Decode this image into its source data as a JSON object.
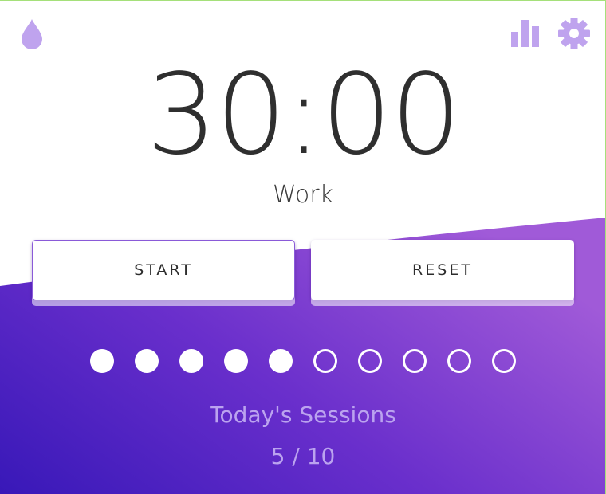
{
  "timer": {
    "display": "30:00",
    "mode": "Work"
  },
  "controls": {
    "start_label": "START",
    "reset_label": "RESET"
  },
  "icons": {
    "left": "drop-icon",
    "stats": "bar-chart-icon",
    "settings": "gear-icon"
  },
  "sessions": {
    "label": "Today's Sessions",
    "count_text": "5 / 10",
    "completed": 5,
    "total": 10
  },
  "colors": {
    "accent": "#bfa3ee",
    "gradient_start": "#3818b8",
    "gradient_end": "#a05ad8",
    "timer_text": "#2f2f2f",
    "sessions_text": "#bba3ef"
  }
}
